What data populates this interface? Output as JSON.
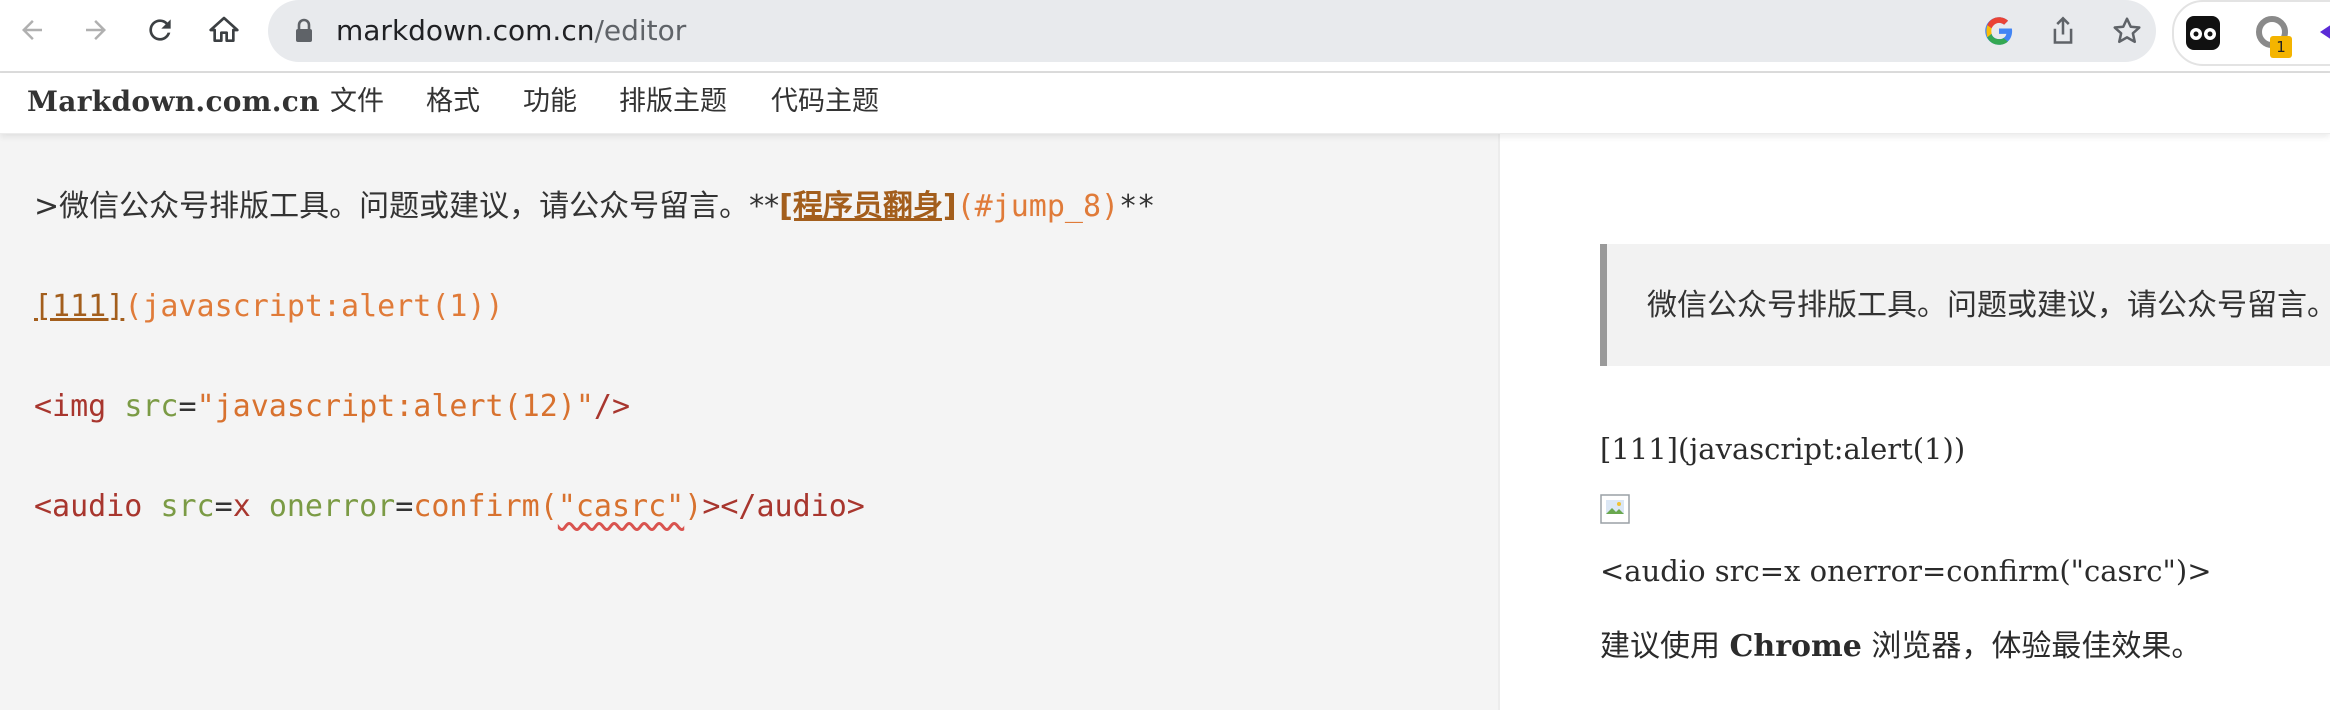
{
  "browser": {
    "url_host": "markdown.com.cn",
    "url_path": "/editor",
    "extension_badge": "1",
    "colors": {
      "omnibox": "#e8eaed",
      "badge": "#f4b400"
    }
  },
  "app": {
    "brand": "Markdown.com.cn",
    "menu": [
      "文件",
      "格式",
      "功能",
      "排版主题",
      "代码主题"
    ]
  },
  "editor": {
    "line1": {
      "prefix": ">微信公众号排版工具。问题或建议，请公众号留言。**",
      "link_text": "[程序员翻身]",
      "link_url": "(#jump_8)",
      "suffix": "**"
    },
    "line2": {
      "link_text": "[111]",
      "link_url": "(javascript:alert(1))"
    },
    "line3": {
      "tag_open": "<img",
      "attr": "src",
      "eq": "=",
      "value": "\"javascript:alert(12)\"",
      "tag_close": "/>"
    },
    "line4": {
      "tag_open": "<audio",
      "attr1": "src",
      "eq1": "=",
      "val1": "x",
      "attr2": "onerror",
      "eq2": "=",
      "func": "confirm(",
      "str": "\"casrc\"",
      "func_close": ")",
      "tag_rest": "></audio>"
    }
  },
  "preview": {
    "blockquote": "微信公众号排版工具。问题或建议，请公众号留言。",
    "line_link": "[111](javascript:alert(1))",
    "line_audio": "<audio src=x onerror=confirm(\"casrc\")>",
    "tip_before": "建议使用 ",
    "tip_bold": "Chrome",
    "tip_after": " 浏览器，体验最佳效果。"
  }
}
